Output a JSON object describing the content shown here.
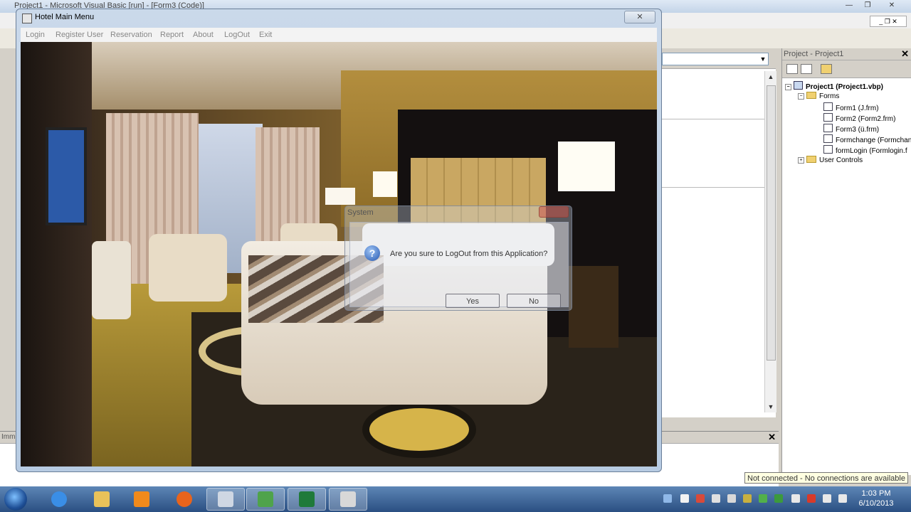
{
  "ide": {
    "window_title": "Project1 - Microsoft Visual Basic [run] - [Form3 (Code)]",
    "immediate_label": "Imm",
    "project_explorer": {
      "title": "Project - Project1",
      "items": [
        {
          "label": "Project1 (Project1.vbp)",
          "type": "project"
        },
        {
          "label": "Forms",
          "type": "folder"
        },
        {
          "label": "Form1 (J.frm)",
          "type": "form"
        },
        {
          "label": "Form2 (Form2.frm)",
          "type": "form"
        },
        {
          "label": "Form3 (ü.frm)",
          "type": "form"
        },
        {
          "label": "Formchange (Formchange",
          "type": "form"
        },
        {
          "label": "formLogin (Formlogin.f",
          "type": "form"
        },
        {
          "label": "User Controls",
          "type": "folder"
        }
      ]
    },
    "status_tooltip": "Not connected - No connections are available"
  },
  "hotel_form": {
    "title": "Hotel Main Menu",
    "close_symbol": "✕",
    "menu": [
      "Login",
      "Register User",
      "Reservation",
      "Report",
      "About",
      "LogOut",
      "Exit"
    ]
  },
  "dialog": {
    "title": "System",
    "message": "Are you sure to LogOut from this Application?",
    "yes_label": "Yes",
    "no_label": "No",
    "icon": "question-icon"
  },
  "taskbar": {
    "apps": [
      {
        "name": "internet-explorer-icon",
        "color": "#3a8ee6"
      },
      {
        "name": "file-explorer-icon",
        "color": "#e9c25a"
      },
      {
        "name": "media-player-icon",
        "color": "#f08a1c"
      },
      {
        "name": "firefox-icon",
        "color": "#e8641c"
      },
      {
        "name": "computer-icon",
        "color": "#cfd7e3"
      },
      {
        "name": "visual-basic-icon",
        "color": "#4fa34b"
      },
      {
        "name": "excel-icon",
        "color": "#1f7a3a"
      },
      {
        "name": "screen-recorder-icon",
        "color": "#d8d8d8"
      }
    ],
    "time": "1:03 PM",
    "date": "6/10/2013"
  }
}
